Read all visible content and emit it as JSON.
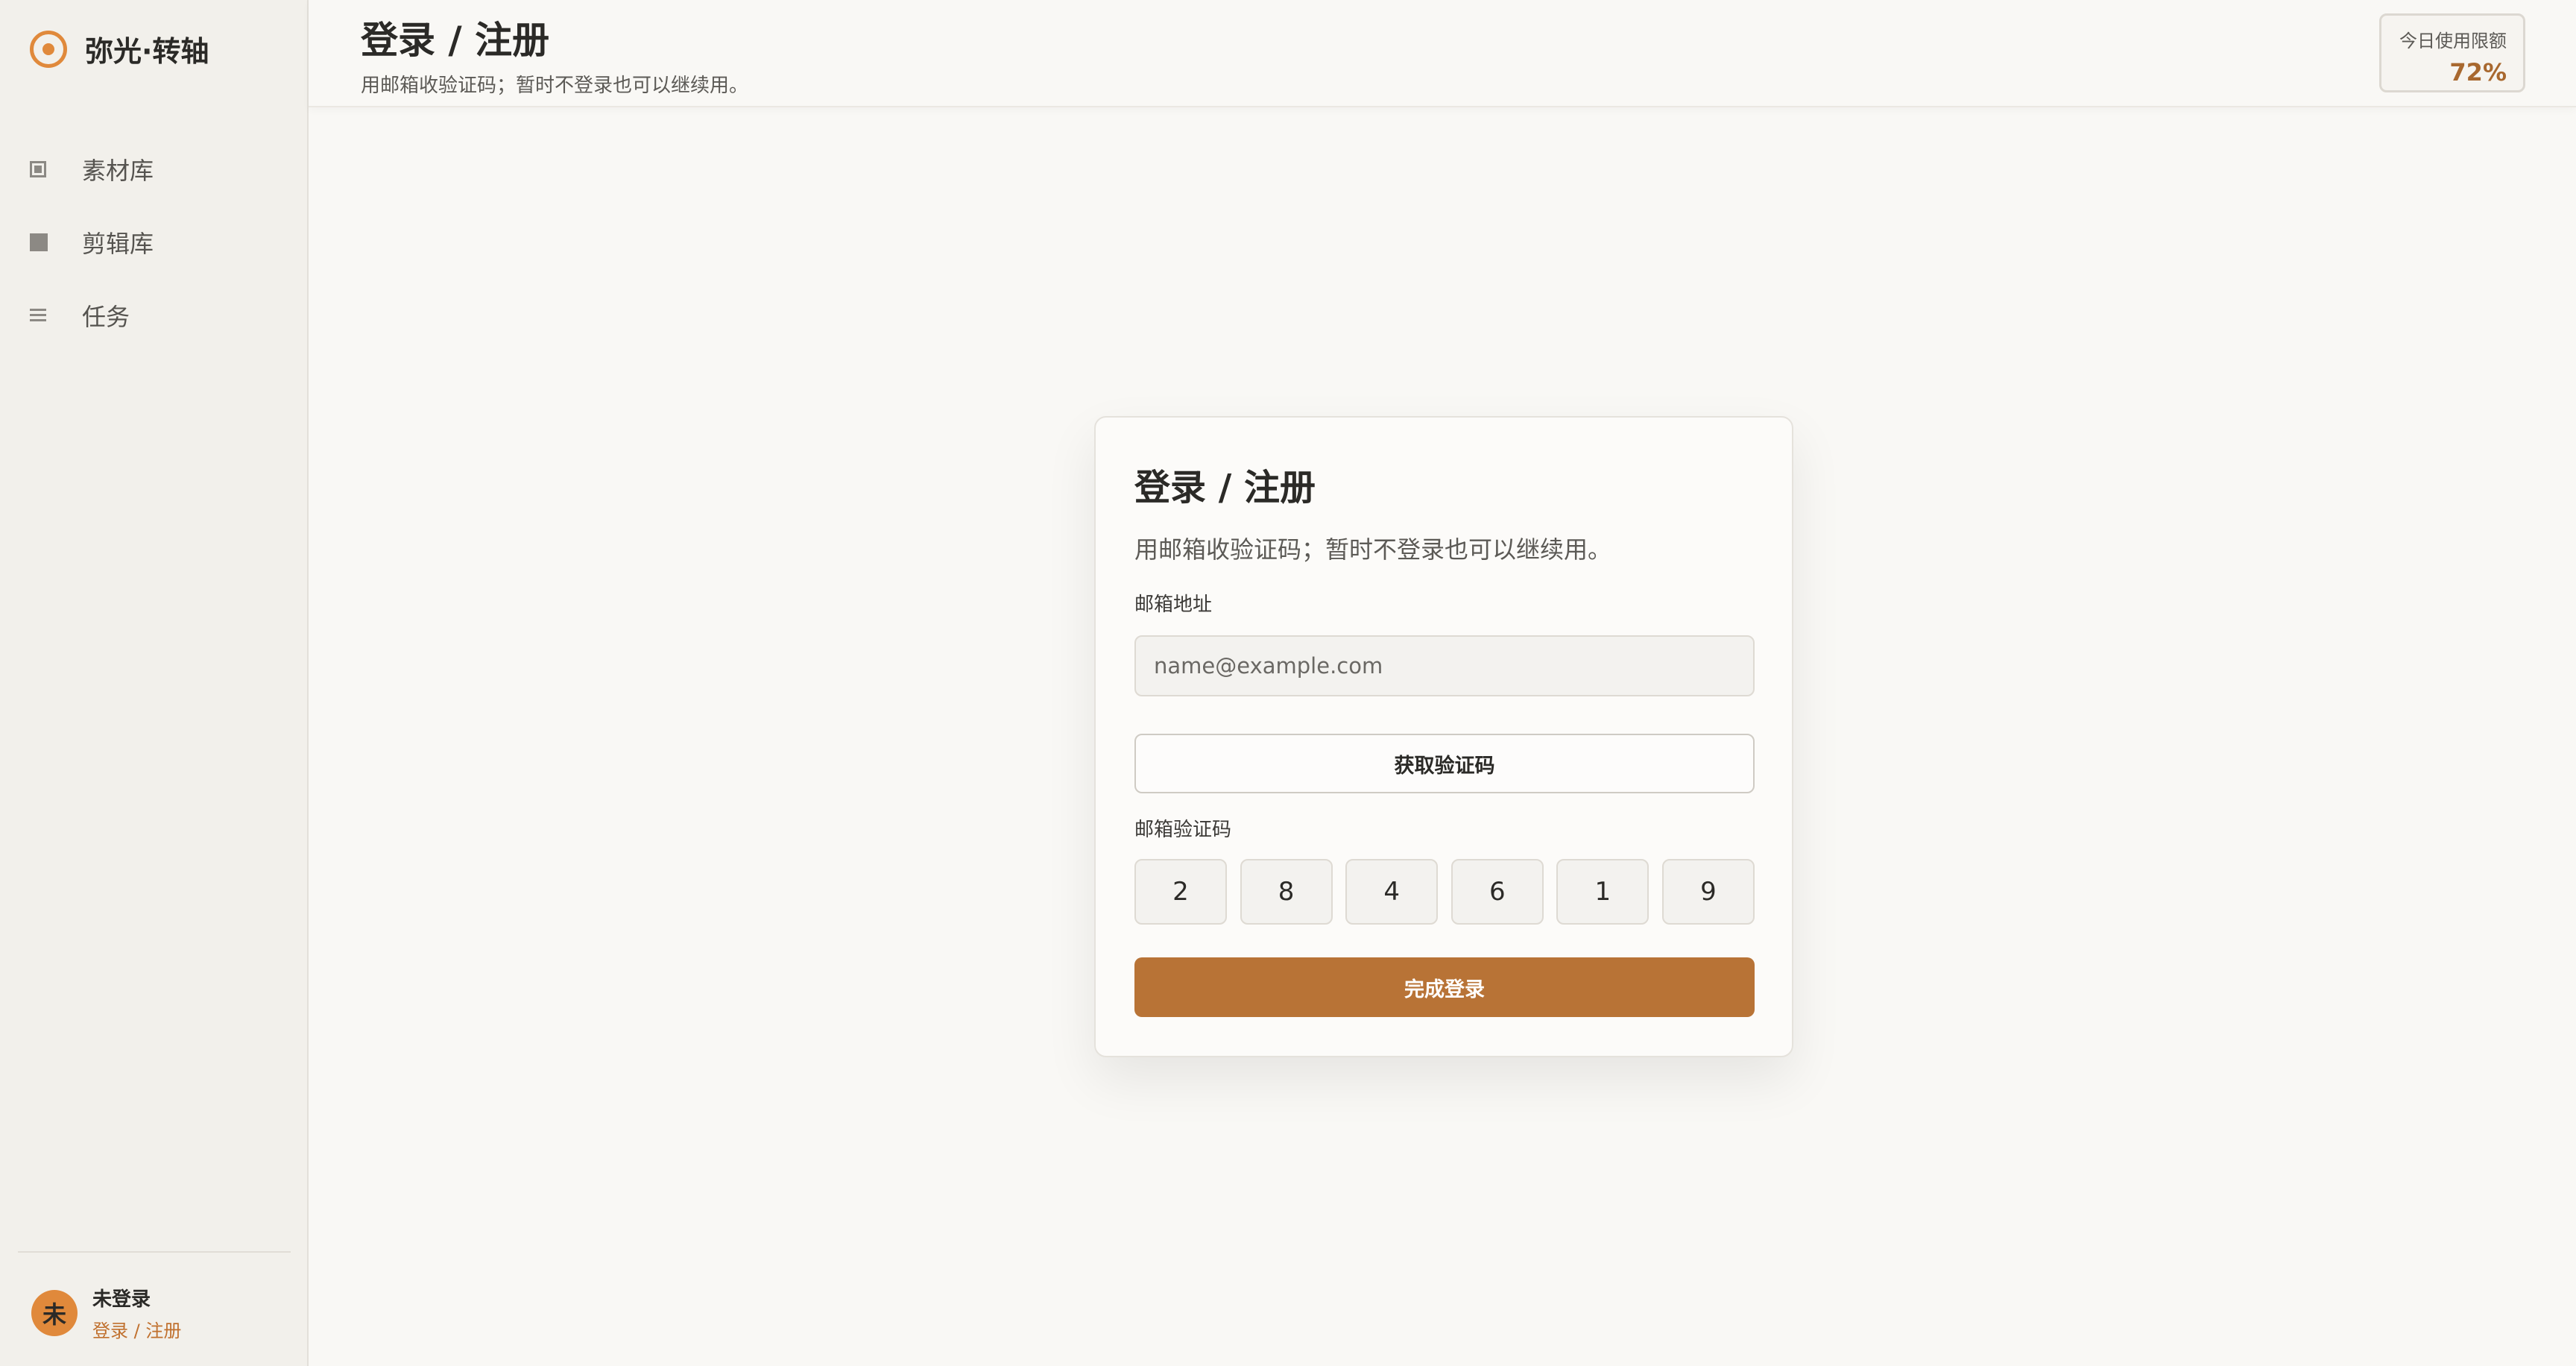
{
  "brand": {
    "name": "弥光·转轴",
    "logo_icon": "circle-logo-icon",
    "accent": "#e0893b"
  },
  "sidebar": {
    "items": [
      {
        "label": "素材库",
        "icon": "framed-square-icon"
      },
      {
        "label": "剪辑库",
        "icon": "filled-square-icon"
      },
      {
        "label": "任务",
        "icon": "list-icon"
      }
    ]
  },
  "user": {
    "avatar_text": "未",
    "name": "未登录",
    "link": "登录 / 注册"
  },
  "header": {
    "title": "登录 / 注册",
    "subtitle": "用邮箱收验证码；暂时不登录也可以继续用。",
    "quota_label": "今日使用限额",
    "quota_value": "72%"
  },
  "card": {
    "title": "登录 / 注册",
    "subtitle": "用邮箱收验证码；暂时不登录也可以继续用。",
    "email_label": "邮箱地址",
    "email_placeholder": "name@example.com",
    "email_value": "",
    "get_code_label": "获取验证码",
    "code_label": "邮箱验证码",
    "code_digits": [
      "2",
      "8",
      "4",
      "6",
      "1",
      "9"
    ],
    "submit_label": "完成登录"
  },
  "colors": {
    "primary": "#b87336",
    "link": "#c0702e",
    "background": "#f9f8f5"
  }
}
